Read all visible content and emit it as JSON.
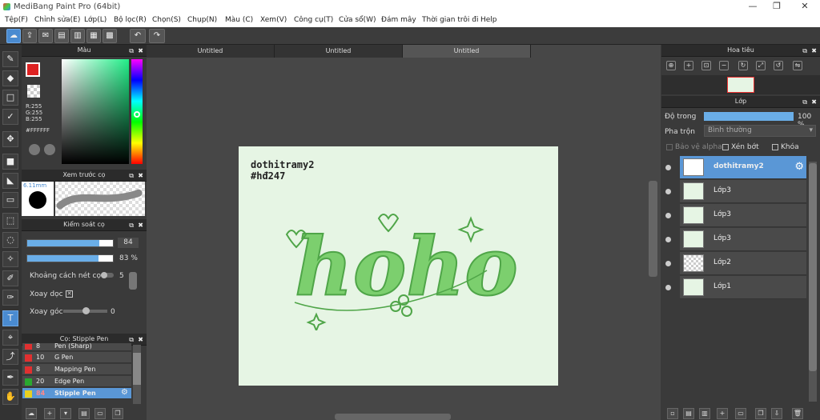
{
  "window": {
    "title": "MediBang Paint Pro (64bit)",
    "minimize": "—",
    "maximize": "❐",
    "close": "✕"
  },
  "menu": [
    "Tệp(F)",
    "Chỉnh sửa(E)",
    "Lớp(L)",
    "Bộ lọc(R)",
    "Chọn(S)",
    "Chụp(N)",
    "Màu (C)",
    "Xem(V)",
    "Công cụ(T)",
    "Cửa sổ(W)",
    "Đám mây",
    "Thời gian trôi đi",
    "Help"
  ],
  "color_panel": {
    "title": "Màu",
    "r": "R:255",
    "g": "G:255",
    "b": "B:255",
    "hex": "#FFFFFF"
  },
  "brush_preview": {
    "title": "Xem trước cọ",
    "size": "6.11mm"
  },
  "brush_control": {
    "title": "Kiểm soát cọ",
    "size_value": "84",
    "opacity_value": "83 %",
    "stroke_spacing_label": "Khoảng cách nét cọ",
    "stroke_spacing_value": "5",
    "rotate_label": "Xoay dọc",
    "angle_label": "Xoay góc",
    "angle_value": "0",
    "rotate_checked": true
  },
  "brush_list": {
    "title": "Cọ: Stipple Pen",
    "items": [
      {
        "num": "8",
        "name": "Pen (Sharp)",
        "color": "#e03030"
      },
      {
        "num": "10",
        "name": "G Pen",
        "color": "#e03030"
      },
      {
        "num": "8",
        "name": "Mapping Pen",
        "color": "#e03030"
      },
      {
        "num": "20",
        "name": "Edge Pen",
        "color": "#2aa830"
      },
      {
        "num": "84",
        "name": "Stipple Pen",
        "color": "#e8d020",
        "selected": true
      }
    ]
  },
  "tabs": [
    "Untitled",
    "Untitled",
    "Untitled"
  ],
  "canvas": {
    "line1": "dothitramy2",
    "line2": "#hđ247",
    "art_text": "hoho"
  },
  "navigator": {
    "title": "Hoa tiêu"
  },
  "layers_panel": {
    "title": "Lớp",
    "opacity_label": "Độ trong",
    "opacity_value": "100 %",
    "opacity_fraction": 1.0,
    "blend_label": "Pha trộn",
    "blend_value": "Bình thường",
    "protect_alpha": "Bảo vệ alpha",
    "clipping": "Xén bớt",
    "lock": "Khóa",
    "layers": [
      {
        "name": "dothitramy2",
        "selected": true
      },
      {
        "name": "Lớp3"
      },
      {
        "name": "Lớp3"
      },
      {
        "name": "Lớp3"
      },
      {
        "name": "Lớp2"
      },
      {
        "name": "Lớp1"
      }
    ]
  },
  "colors": {
    "accent": "#4a8bd0",
    "paper": "#e6f5e4",
    "art_green": "#7ccf6e"
  }
}
